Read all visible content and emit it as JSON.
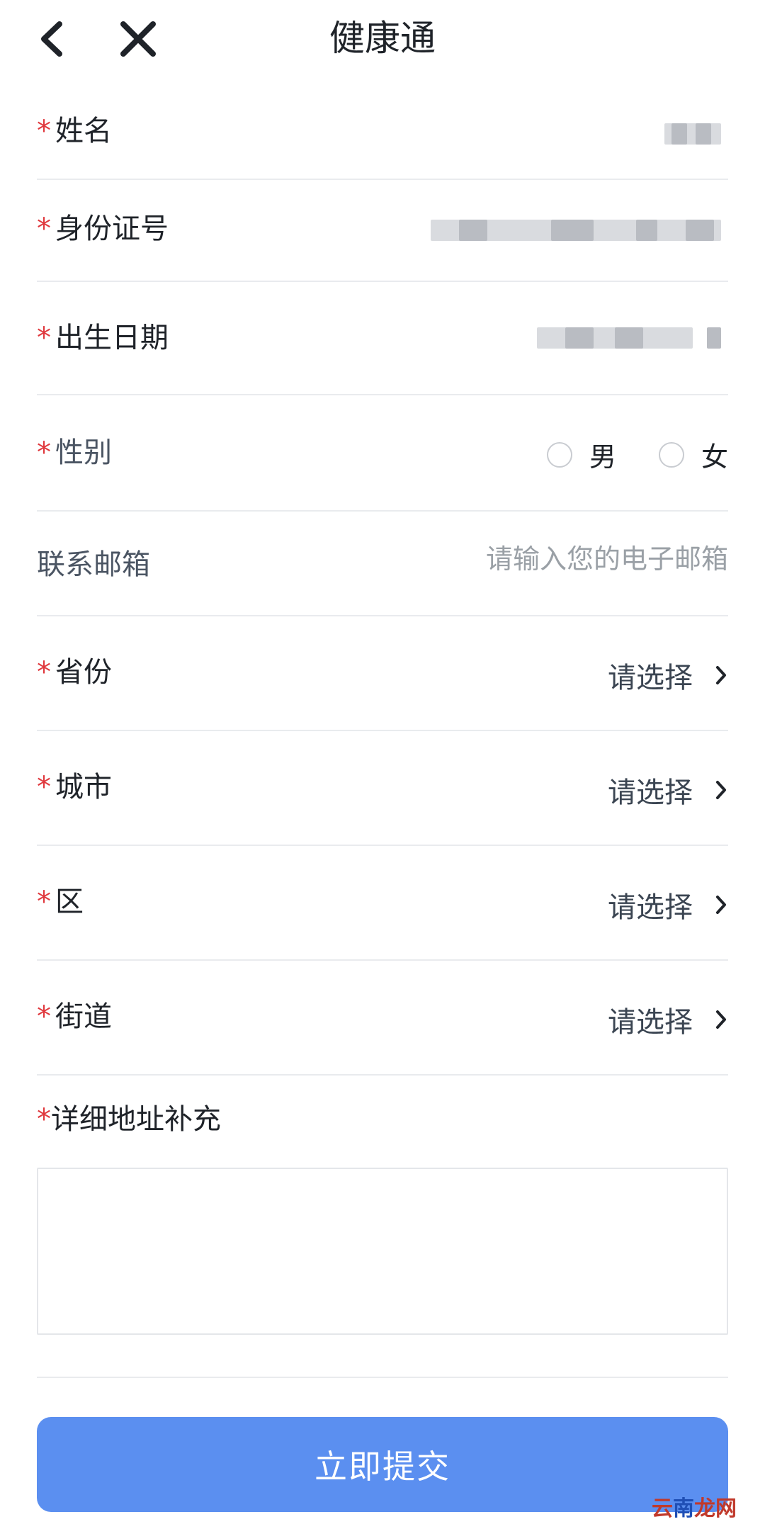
{
  "header": {
    "title": "健康通"
  },
  "form": {
    "name_label": "姓名",
    "id_label": "身份证号",
    "birth_label": "出生日期",
    "gender_label": "性别",
    "gender_male": "男",
    "gender_female": "女",
    "email_label": "联系邮箱",
    "email_placeholder": "请输入您的电子邮箱",
    "email_value": "",
    "province_label": "省份",
    "city_label": "城市",
    "district_label": "区",
    "street_label": "街道",
    "select_placeholder": "请选择",
    "address_label": "详细地址补充",
    "address_value": "",
    "required_mark": "*"
  },
  "submit_label": "立即提交",
  "watermark": {
    "part1": "云",
    "part2": "南",
    "part3": "龙网"
  },
  "colors": {
    "accent": "#5b8ff0",
    "required": "#e0393e",
    "divider": "#e9ebee"
  },
  "icons": {
    "back": "chevron-left-icon",
    "close": "close-icon",
    "select": "chevron-right-icon",
    "radio": "radio-circle-icon"
  }
}
